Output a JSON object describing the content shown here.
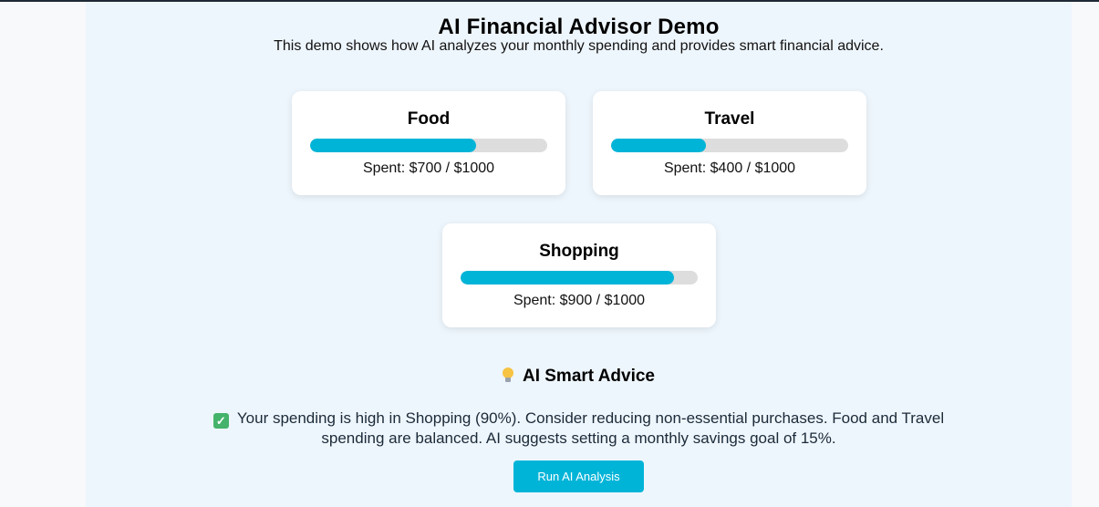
{
  "header": {
    "title": "AI Financial Advisor Demo",
    "subtitle": "This demo shows how AI analyzes your monthly spending and provides smart financial advice."
  },
  "categories": [
    {
      "name": "Food",
      "spent": 700,
      "budget": 1000,
      "spent_text": "Spent: $700 / $1000",
      "progress": 0.7
    },
    {
      "name": "Travel",
      "spent": 400,
      "budget": 1000,
      "spent_text": "Spent: $400 / $1000",
      "progress": 0.4
    },
    {
      "name": "Shopping",
      "spent": 900,
      "budget": 1000,
      "spent_text": "Spent: $900 / $1000",
      "progress": 0.9
    }
  ],
  "advice": {
    "heading": "AI Smart Advice",
    "heading_icon": "lightbulb-icon",
    "check_icon": "check-mark-icon",
    "text": "Your spending is high in Shopping (90%). Consider reducing non-essential purchases. Food and Travel spending are balanced. AI suggests setting a monthly savings goal of 15%."
  },
  "actions": {
    "run_label": "Run AI Analysis"
  },
  "colors": {
    "accent": "#00b4d8",
    "track": "#dddddd",
    "panel": "#eef6fd",
    "card": "#ffffff"
  }
}
